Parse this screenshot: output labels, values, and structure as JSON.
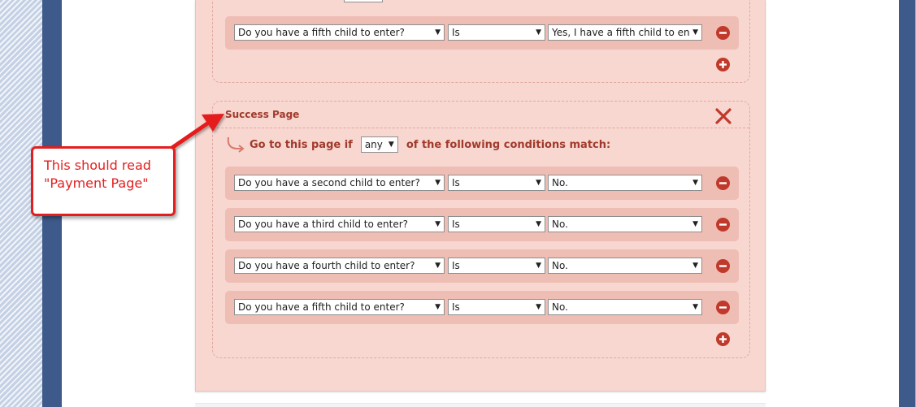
{
  "prev_rule": {
    "condition": {
      "field": "Do you have a fifth child to enter?",
      "operator": "Is",
      "value": "Yes, I have a fifth child to en"
    }
  },
  "success_rule": {
    "title": "Success Page",
    "goto_prefix": "Go to this page if",
    "match_mode": "any",
    "goto_suffix": "of the following conditions match:",
    "conditions": [
      {
        "field": "Do you have a second child to enter?",
        "operator": "Is",
        "value": "No."
      },
      {
        "field": "Do you have a third child to enter?",
        "operator": "Is",
        "value": "No."
      },
      {
        "field": "Do you have a fourth child to enter?",
        "operator": "Is",
        "value": "No."
      },
      {
        "field": "Do you have a fifth child to enter?",
        "operator": "Is",
        "value": "No."
      }
    ]
  },
  "annotation": {
    "line1": "This should read",
    "line2": "\"Payment Page\""
  },
  "colors": {
    "accent": "#a03a2c",
    "panel": "#f8d7d1",
    "row": "#eebdb4",
    "annotation": "#e41e1e",
    "sidebar_blue": "#3d5a8a"
  },
  "icons": {
    "close": "close-x-icon",
    "remove": "minus-circle-icon",
    "add": "plus-circle-icon",
    "redirect": "curved-arrow-icon"
  }
}
